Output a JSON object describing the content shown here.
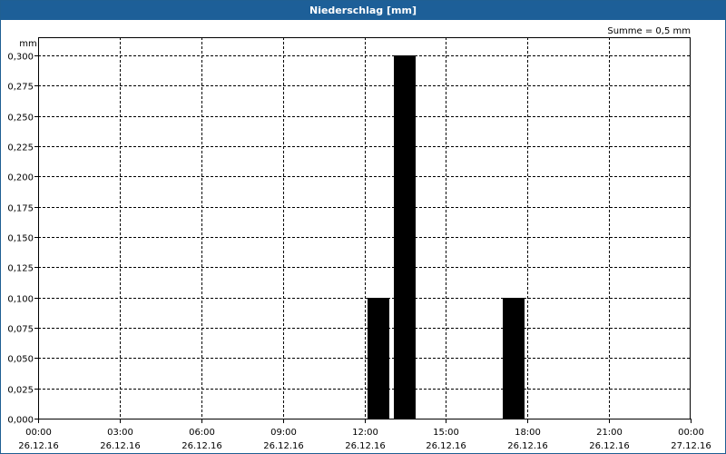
{
  "window": {
    "title": "Niederschlag [mm]"
  },
  "summary": "Summe = 0,5 mm",
  "chart_data": {
    "type": "bar",
    "title": "Niederschlag [mm]",
    "ylabel": "mm",
    "xlabel": "",
    "ylim": [
      0,
      0.3
    ],
    "yticks": [
      0,
      0.025,
      0.05,
      0.075,
      0.1,
      0.125,
      0.15,
      0.175,
      0.2,
      0.225,
      0.25,
      0.275,
      0.3
    ],
    "ytick_labels": [
      "0,000",
      "0,025",
      "0,050",
      "0,075",
      "0,100",
      "0,125",
      "0,150",
      "0,175",
      "0,200",
      "0,225",
      "0,250",
      "0,275",
      "0,300"
    ],
    "xlim": [
      "26.12.16 00:00",
      "27.12.16 00:00"
    ],
    "xtick_labels": [
      {
        "time": "00:00",
        "date": "26.12.16"
      },
      {
        "time": "03:00",
        "date": "26.12.16"
      },
      {
        "time": "06:00",
        "date": "26.12.16"
      },
      {
        "time": "09:00",
        "date": "26.12.16"
      },
      {
        "time": "12:00",
        "date": "26.12.16"
      },
      {
        "time": "15:00",
        "date": "26.12.16"
      },
      {
        "time": "18:00",
        "date": "26.12.16"
      },
      {
        "time": "21:00",
        "date": "26.12.16"
      },
      {
        "time": "00:00",
        "date": "27.12.16"
      }
    ],
    "bars": [
      {
        "start": "26.12.16 12:00",
        "end": "26.12.16 13:00",
        "value": 0.1
      },
      {
        "start": "26.12.16 13:00",
        "end": "26.12.16 14:00",
        "value": 0.3
      },
      {
        "start": "26.12.16 17:00",
        "end": "26.12.16 18:00",
        "value": 0.1
      }
    ],
    "grid": true,
    "bar_color": "#000000",
    "grid_color": "#000000"
  }
}
